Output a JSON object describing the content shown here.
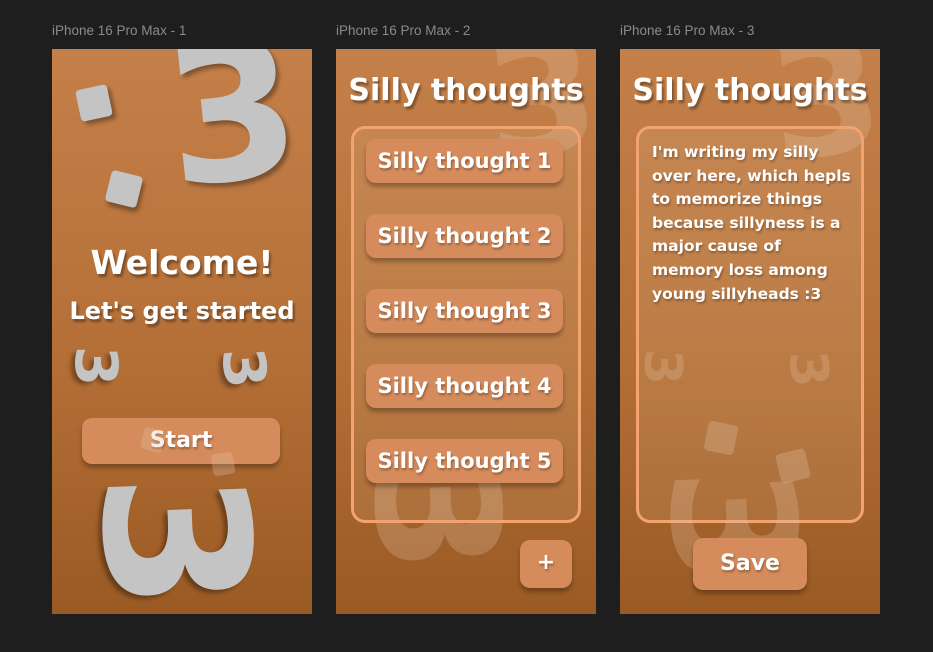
{
  "frames": [
    {
      "label": "iPhone 16 Pro Max - 1"
    },
    {
      "label": "iPhone 16 Pro Max - 2"
    },
    {
      "label": "iPhone 16 Pro Max - 3"
    }
  ],
  "welcome": {
    "heading": "Welcome!",
    "subheading": "Let's get started",
    "start_label": "Start",
    "face_glyph": ":3",
    "small_glyph": "3"
  },
  "list": {
    "title": "Silly thoughts",
    "items": [
      {
        "label": "Silly thought 1"
      },
      {
        "label": "Silly thought 2"
      },
      {
        "label": "Silly thought 3"
      },
      {
        "label": "Silly thought 4"
      },
      {
        "label": "Silly thought 5"
      }
    ],
    "add_label": "+"
  },
  "editor": {
    "title": "Silly thoughts",
    "note": "I'm writing my silly over here, which hepls to memorize things because sillyness is a major cause of memory loss among young sillyheads :3",
    "save_label": "Save"
  },
  "colors": {
    "background": "#1e1e1e",
    "frame_top": "#c5804a",
    "button": "#d58b5b",
    "panel_border": "#f2a36f",
    "face": "#c4c4c4"
  }
}
